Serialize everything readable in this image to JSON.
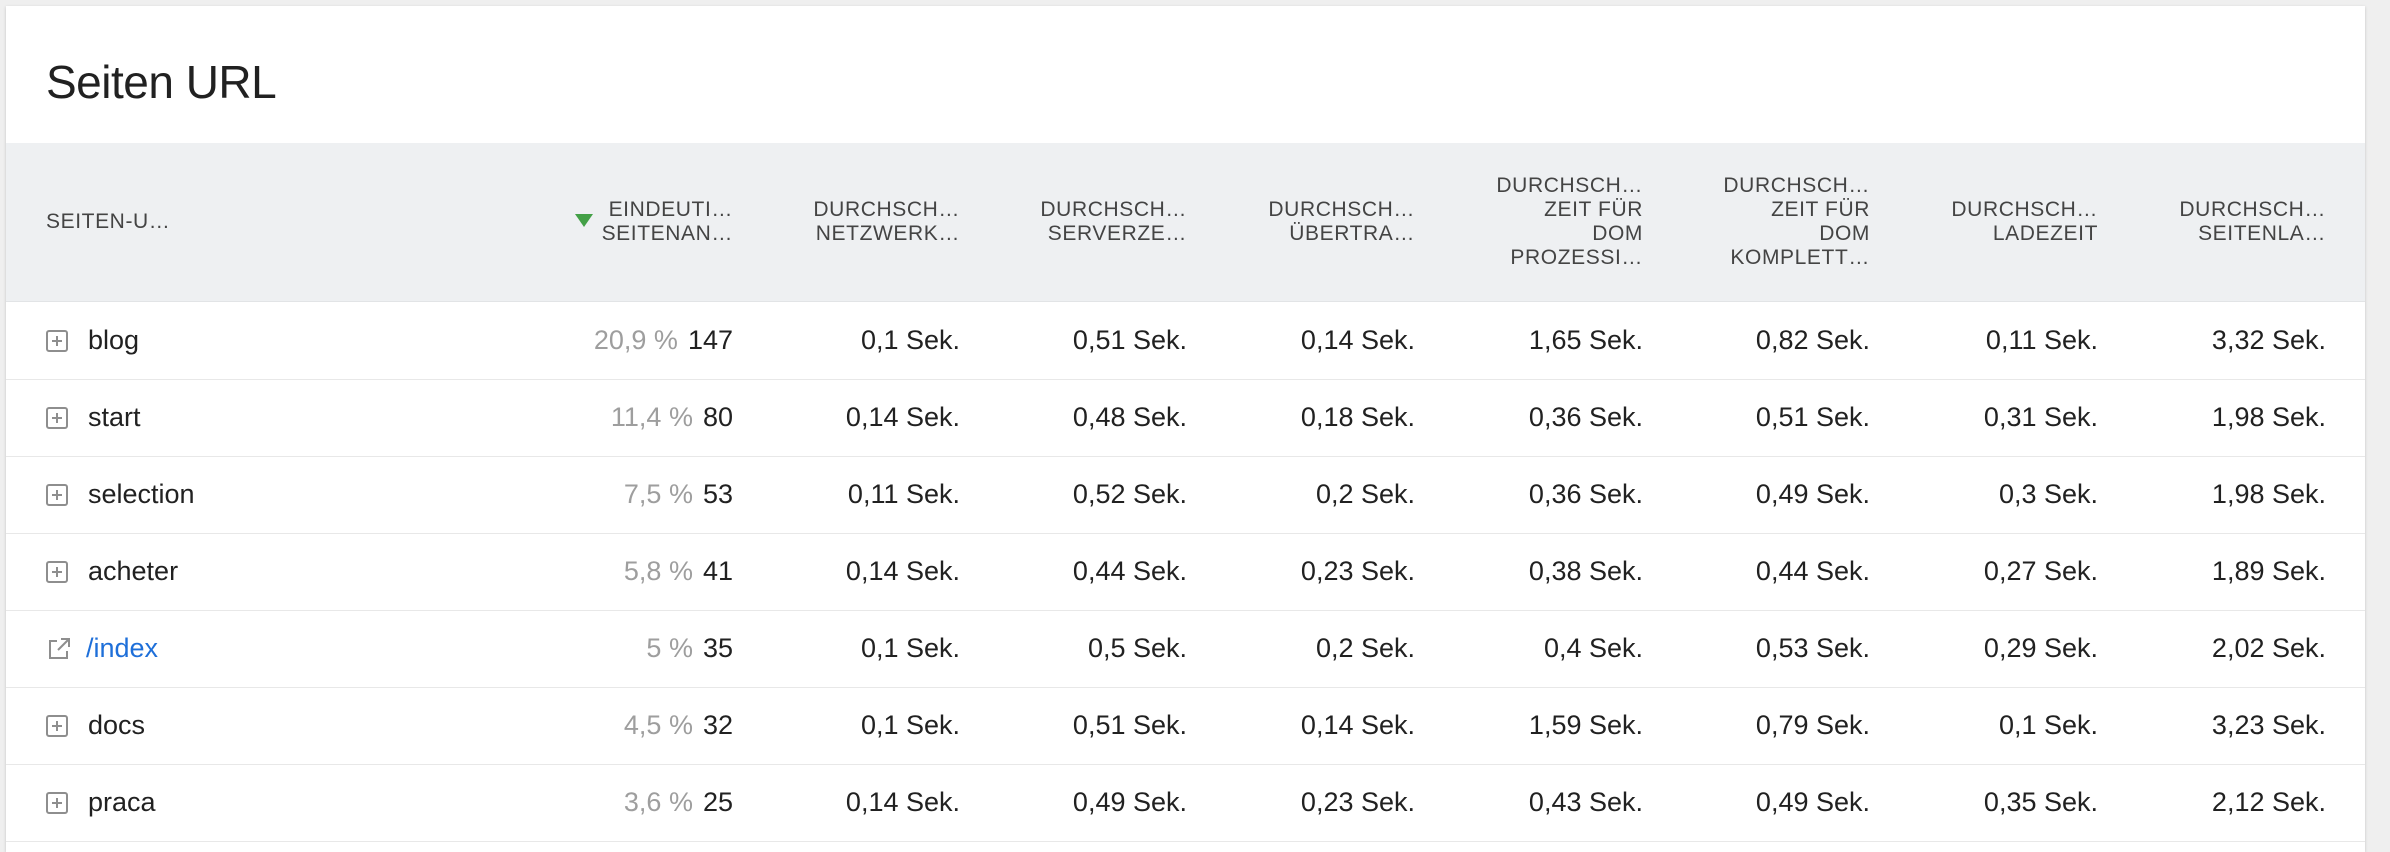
{
  "title": "Seiten URL",
  "colors": {
    "header_bg": "#eef0f2",
    "sort_arrow": "#43a047",
    "link": "#1e6fd9",
    "percent_text": "#9e9e9e"
  },
  "columns": [
    {
      "lines": [
        "SEITEN-U…"
      ],
      "sorted": false
    },
    {
      "lines": [
        "EINDEUTI…",
        "SEITENAN…"
      ],
      "sorted": true,
      "sort_direction": "desc"
    },
    {
      "lines": [
        "DURCHSCH…",
        "NETZWERK…"
      ],
      "sorted": false
    },
    {
      "lines": [
        "DURCHSCH…",
        "SERVERZE…"
      ],
      "sorted": false
    },
    {
      "lines": [
        "DURCHSCH…",
        "ÜBERTRA…"
      ],
      "sorted": false
    },
    {
      "lines": [
        "DURCHSCH…",
        "ZEIT FÜR",
        "DOM",
        "PROZESSI…"
      ],
      "sorted": false
    },
    {
      "lines": [
        "DURCHSCH…",
        "ZEIT FÜR",
        "DOM",
        "KOMPLETT…"
      ],
      "sorted": false
    },
    {
      "lines": [
        "DURCHSCH…",
        "LADEZEIT"
      ],
      "sorted": false
    },
    {
      "lines": [
        "DURCHSCH…",
        "SEITENLA…"
      ],
      "sorted": false
    }
  ],
  "rows": [
    {
      "label": "blog",
      "icon": "expand-icon",
      "percent": "20,9 %",
      "count": "147",
      "values": [
        "0,1 Sek.",
        "0,51 Sek.",
        "0,14 Sek.",
        "1,65 Sek.",
        "0,82 Sek.",
        "0,11 Sek.",
        "3,32 Sek."
      ]
    },
    {
      "label": "start",
      "icon": "expand-icon",
      "percent": "11,4 %",
      "count": "80",
      "values": [
        "0,14 Sek.",
        "0,48 Sek.",
        "0,18 Sek.",
        "0,36 Sek.",
        "0,51 Sek.",
        "0,31 Sek.",
        "1,98 Sek."
      ]
    },
    {
      "label": "selection",
      "icon": "expand-icon",
      "percent": "7,5 %",
      "count": "53",
      "values": [
        "0,11 Sek.",
        "0,52 Sek.",
        "0,2 Sek.",
        "0,36 Sek.",
        "0,49 Sek.",
        "0,3 Sek.",
        "1,98 Sek."
      ]
    },
    {
      "label": "acheter",
      "icon": "expand-icon",
      "percent": "5,8 %",
      "count": "41",
      "values": [
        "0,14 Sek.",
        "0,44 Sek.",
        "0,23 Sek.",
        "0,38 Sek.",
        "0,44 Sek.",
        "0,27 Sek.",
        "1,89 Sek."
      ]
    },
    {
      "label": "/index",
      "icon": "external-link-icon",
      "link": true,
      "percent": "5 %",
      "count": "35",
      "values": [
        "0,1 Sek.",
        "0,5 Sek.",
        "0,2 Sek.",
        "0,4 Sek.",
        "0,53 Sek.",
        "0,29 Sek.",
        "2,02 Sek."
      ]
    },
    {
      "label": "docs",
      "icon": "expand-icon",
      "percent": "4,5 %",
      "count": "32",
      "values": [
        "0,1 Sek.",
        "0,51 Sek.",
        "0,14 Sek.",
        "1,59 Sek.",
        "0,79 Sek.",
        "0,1 Sek.",
        "3,23 Sek."
      ]
    },
    {
      "label": "praca",
      "icon": "expand-icon",
      "percent": "3,6 %",
      "count": "25",
      "values": [
        "0,14 Sek.",
        "0,49 Sek.",
        "0,23 Sek.",
        "0,43 Sek.",
        "0,49 Sek.",
        "0,35 Sek.",
        "2,12 Sek."
      ]
    }
  ]
}
